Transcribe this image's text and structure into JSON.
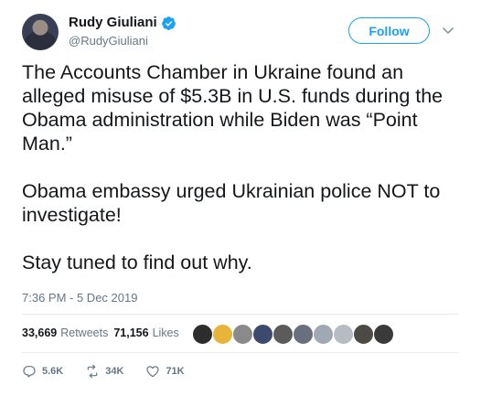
{
  "user": {
    "name": "Rudy Giuliani",
    "handle": "@RudyGiuliani",
    "verified": true
  },
  "follow_label": "Follow",
  "tweet": {
    "paragraphs": [
      "The Accounts Chamber in Ukraine found an alleged misuse of $5.3B in U.S. funds during the Obama administration while Biden was “Point Man.”",
      "Obama embassy urged Ukrainian police NOT to investigate!",
      "Stay tuned to find out why."
    ],
    "timestamp": "7:36 PM - 5 Dec 2019"
  },
  "stats": {
    "retweets_count": "33,669",
    "retweets_label": "Retweets",
    "likes_count": "71,156",
    "likes_label": "Likes"
  },
  "liker_avatars": [
    "#2d2d2d",
    "#e8b53a",
    "#8a8a8a",
    "#3c4a6e",
    "#5b5b5b",
    "#6a6f7d",
    "#9fa8b3",
    "#b7bcc4",
    "#4d4a45",
    "#3a3a3a"
  ],
  "actions": {
    "replies": "5.6K",
    "retweets": "34K",
    "likes": "71K"
  },
  "colors": {
    "accent": "#1da1f2",
    "secondary_text": "#657786",
    "divider": "#e6ecf0"
  }
}
